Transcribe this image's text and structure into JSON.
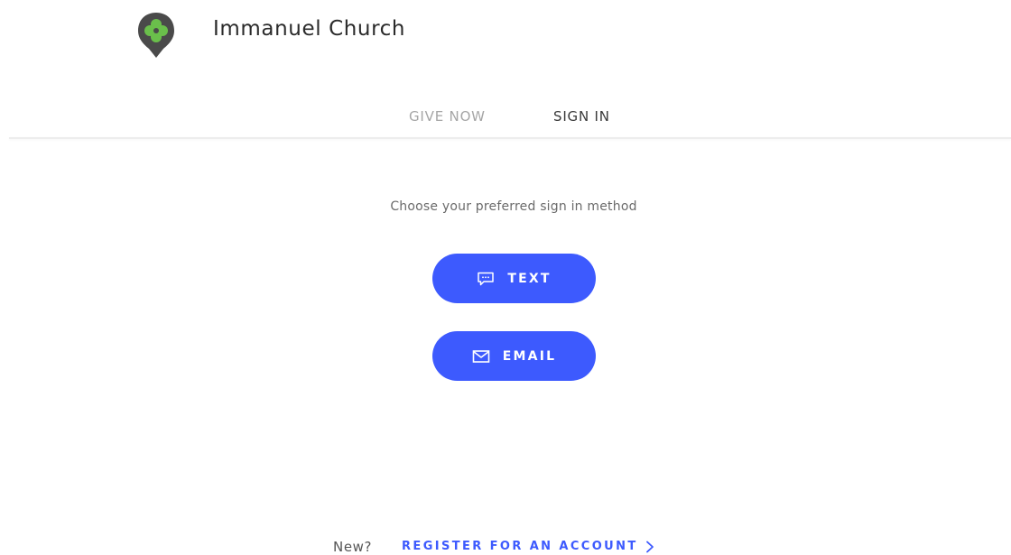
{
  "header": {
    "org_name": "Immanuel Church",
    "logo_icon": "clover-pin-icon"
  },
  "nav": {
    "give_now": "GIVE NOW",
    "sign_in": "SIGN IN"
  },
  "signin": {
    "prompt": "Choose your preferred sign in method",
    "text_label": "TEXT",
    "text_icon": "chat-bubble-icon",
    "email_label": "EMAIL",
    "email_icon": "envelope-icon"
  },
  "footer": {
    "new_label": "New?",
    "register_label": "REGISTER FOR AN ACCOUNT",
    "register_icon": "chevron-right-icon"
  },
  "colors": {
    "accent": "#3d5afe",
    "logo_dark": "#4a4a4a",
    "logo_green": "#6abf4b"
  }
}
